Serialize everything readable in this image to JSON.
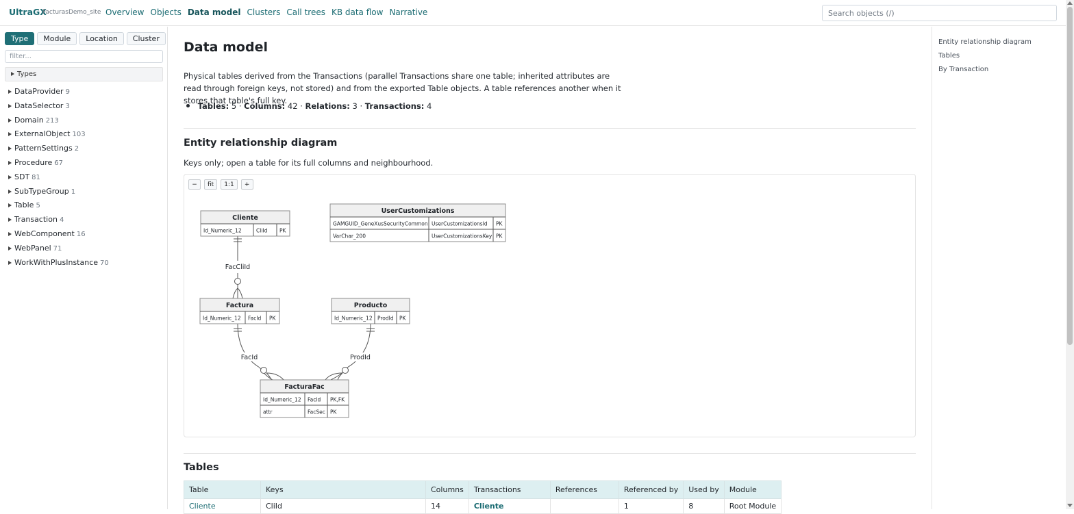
{
  "header": {
    "brand": "UltraGX",
    "site": "FacturasDemo_site",
    "nav": [
      {
        "label": "Overview",
        "active": false
      },
      {
        "label": "Objects",
        "active": false
      },
      {
        "label": "Data model",
        "active": true
      },
      {
        "label": "Clusters",
        "active": false
      },
      {
        "label": "Call trees",
        "active": false
      },
      {
        "label": "KB data flow",
        "active": false
      },
      {
        "label": "Narrative",
        "active": false
      }
    ],
    "search_placeholder": "Search objects (/)"
  },
  "sidebar": {
    "tabs": [
      {
        "label": "Type",
        "active": true
      },
      {
        "label": "Module",
        "active": false
      },
      {
        "label": "Location",
        "active": false
      },
      {
        "label": "Cluster",
        "active": false
      }
    ],
    "filter_placeholder": "filter...",
    "group_label": "Types",
    "items": [
      {
        "label": "DataProvider",
        "count": "9"
      },
      {
        "label": "DataSelector",
        "count": "3"
      },
      {
        "label": "Domain",
        "count": "213"
      },
      {
        "label": "ExternalObject",
        "count": "103"
      },
      {
        "label": "PatternSettings",
        "count": "2"
      },
      {
        "label": "Procedure",
        "count": "67"
      },
      {
        "label": "SDT",
        "count": "81"
      },
      {
        "label": "SubTypeGroup",
        "count": "1"
      },
      {
        "label": "Table",
        "count": "5"
      },
      {
        "label": "Transaction",
        "count": "4"
      },
      {
        "label": "WebComponent",
        "count": "16"
      },
      {
        "label": "WebPanel",
        "count": "71"
      },
      {
        "label": "WorkWithPlusInstance",
        "count": "70"
      }
    ]
  },
  "main": {
    "title": "Data model",
    "intro": "Physical tables derived from the Transactions (parallel Transactions share one table; inherited attributes are read through foreign keys, not stored) and from the exported Table objects. A table references another when it stores that table's full key.",
    "stats": {
      "tables_label": "Tables:",
      "tables": "5",
      "columns_label": "Columns:",
      "columns": "42",
      "relations_label": "Relations:",
      "relations": "3",
      "transactions_label": "Transactions:",
      "transactions": "4",
      "sep": "·"
    },
    "erd": {
      "heading": "Entity relationship diagram",
      "subtitle": "Keys only; open a table for its full columns and neighbourhood.",
      "zoom_buttons": [
        "−",
        "fit",
        "1:1",
        "+"
      ]
    },
    "tables": {
      "heading": "Tables",
      "columns": [
        "Table",
        "Keys",
        "Columns",
        "Transactions",
        "References",
        "Referenced by",
        "Used by",
        "Module"
      ],
      "rows": [
        {
          "table": "Cliente",
          "keys": "CliId",
          "columns": "14",
          "transactions": "Cliente",
          "references": "",
          "referenced_by": "1",
          "used_by": "8",
          "module": "Root Module"
        }
      ]
    }
  },
  "diagram": {
    "entities": [
      {
        "name": "Cliente",
        "rows": [
          [
            "Id_Numeric_12",
            "CliId",
            "PK"
          ]
        ]
      },
      {
        "name": "UserCustomizations",
        "rows": [
          [
            "GAMGUID_GeneXusSecurityCommon",
            "UserCustomizationsId",
            "PK"
          ],
          [
            "VarChar_200",
            "UserCustomizationsKey",
            "PK"
          ]
        ]
      },
      {
        "name": "Factura",
        "rows": [
          [
            "Id_Numeric_12",
            "FacId",
            "PK"
          ]
        ]
      },
      {
        "name": "Producto",
        "rows": [
          [
            "Id_Numeric_12",
            "ProdId",
            "PK"
          ]
        ]
      },
      {
        "name": "FacturaFac",
        "rows": [
          [
            "Id_Numeric_12",
            "FacId",
            "PK,FK"
          ],
          [
            "attr",
            "FacSec",
            "PK"
          ]
        ]
      }
    ],
    "relations": [
      {
        "label": "FacCliId",
        "from": "Cliente",
        "to": "Factura"
      },
      {
        "label": "FacId",
        "from": "Factura",
        "to": "FacturaFac"
      },
      {
        "label": "ProdId",
        "from": "Producto",
        "to": "FacturaFac"
      }
    ]
  },
  "toc": {
    "items": [
      "Entity relationship diagram",
      "Tables",
      "By Transaction"
    ]
  }
}
